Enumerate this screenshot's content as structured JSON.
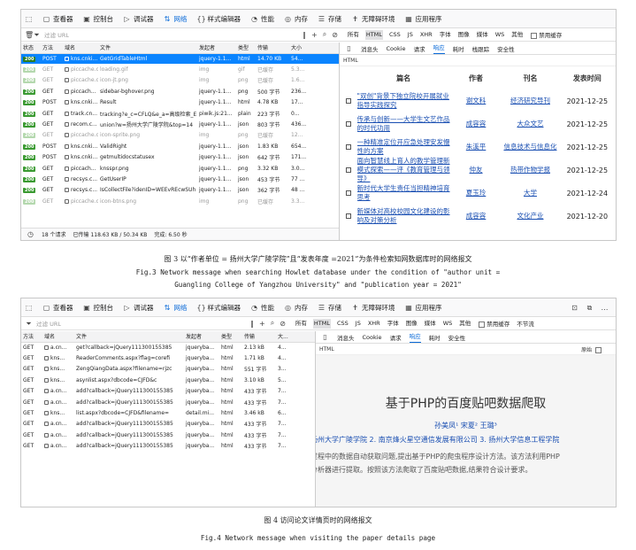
{
  "toolbar1": {
    "tabs": [
      {
        "icon": "▢",
        "label": "查看器"
      },
      {
        "icon": "▣",
        "label": "控制台"
      },
      {
        "icon": "▷",
        "label": "调试器"
      },
      {
        "icon": "⇅",
        "label": "网络",
        "selected": true
      },
      {
        "icon": "{}",
        "label": "样式编辑器"
      },
      {
        "icon": "◔",
        "label": "性能"
      },
      {
        "icon": "◎",
        "label": "内存"
      },
      {
        "icon": "☰",
        "label": "存储"
      },
      {
        "icon": "✝",
        "label": "无障碍环境"
      },
      {
        "icon": "▦",
        "label": "应用程序"
      }
    ]
  },
  "toolbar2": {
    "tabs": [
      {
        "icon": "▢",
        "label": "查看器"
      },
      {
        "icon": "▣",
        "label": "控制台"
      },
      {
        "icon": "▷",
        "label": "调试器"
      },
      {
        "icon": "⇅",
        "label": "网络",
        "selected": true
      },
      {
        "icon": "{}",
        "label": "样式编辑器"
      },
      {
        "icon": "◔",
        "label": "性能"
      },
      {
        "icon": "◎",
        "label": "内存"
      },
      {
        "icon": "☰",
        "label": "存储"
      },
      {
        "icon": "✝",
        "label": "无障碍环境"
      },
      {
        "icon": "▦",
        "label": "应用程序"
      }
    ]
  },
  "filter": {
    "placeholder": "过滤 URL",
    "types": [
      "所有",
      "HTML",
      "CSS",
      "JS",
      "XHR",
      "字体",
      "图像",
      "媒体",
      "WS",
      "其他"
    ],
    "active": "HTML",
    "persist": "禁用缓存",
    "throttle": "不节流"
  },
  "net1": {
    "headers": [
      "状态",
      "方法",
      "域名",
      "文件",
      "发起者",
      "类型",
      "传输",
      "大小"
    ],
    "rows": [
      {
        "status": "200",
        "method": "POST",
        "domain": "kns.cnki...",
        "file": "GetGridTableHtml",
        "initiator": "jquery-1.1...",
        "type": "html",
        "transfer": "14.70 KB",
        "size": "54...",
        "selected": true
      },
      {
        "status": "200",
        "method": "GET",
        "domain": "piccache.c...",
        "file": "loading.gif",
        "initiator": "img",
        "type": "gif",
        "transfer": "已缓存",
        "size": "5.3...",
        "dim": true
      },
      {
        "status": "200",
        "method": "GET",
        "domain": "piccache.c...",
        "file": "icon-jt.png",
        "initiator": "img",
        "type": "png",
        "transfer": "已缓存",
        "size": "1.6...",
        "dim": true
      },
      {
        "status": "200",
        "method": "GET",
        "domain": "piccach...",
        "file": "sidebar-bghover.png",
        "initiator": "jquery-1.1...",
        "type": "png",
        "transfer": "500 字节",
        "size": "236..."
      },
      {
        "status": "200",
        "method": "POST",
        "domain": "kns.cnki...",
        "file": "Result",
        "initiator": "jquery-1.1...",
        "type": "html",
        "transfer": "4.78 KB",
        "size": "17..."
      },
      {
        "status": "200",
        "method": "GET",
        "domain": "track.cn...",
        "file": "tracking?e_c=CFLQ&e_a=高级检索_E",
        "initiator": "piwik.js:21...",
        "type": "plain",
        "transfer": "223 字节",
        "size": "0..."
      },
      {
        "status": "200",
        "method": "GET",
        "domain": "recom.c...",
        "file": "union?w=扬州大学广陵学院&top=14",
        "initiator": "jquery-1.1...",
        "type": "json",
        "transfer": "803 字节",
        "size": "436..."
      },
      {
        "status": "200",
        "method": "GET",
        "domain": "piccache.c...",
        "file": "icon-sprite.png",
        "initiator": "img",
        "type": "png",
        "transfer": "已缓存",
        "size": "12...",
        "dim": true
      },
      {
        "status": "200",
        "method": "POST",
        "domain": "kns.cnki...",
        "file": "ValidRight",
        "initiator": "jquery-1.1...",
        "type": "json",
        "transfer": "1.83 KB",
        "size": "654..."
      },
      {
        "status": "200",
        "method": "POST",
        "domain": "kns.cnki...",
        "file": "getmultidocstatusex",
        "initiator": "jquery-1.1...",
        "type": "json",
        "transfer": "642 字节",
        "size": "171..."
      },
      {
        "status": "200",
        "method": "GET",
        "domain": "piccach...",
        "file": "knsspr.png",
        "initiator": "jquery-1.1...",
        "type": "png",
        "transfer": "3.32 KB",
        "size": "3.0..."
      },
      {
        "status": "200",
        "method": "GET",
        "domain": "recsys.c...",
        "file": "GetUserIP",
        "initiator": "jquery-1.1...",
        "type": "json",
        "transfer": "453 字节",
        "size": "77 ..."
      },
      {
        "status": "200",
        "method": "GET",
        "domain": "recsys.c...",
        "file": "IsCollectFile?idenID=WEEvREcwSUh",
        "initiator": "jquery-1.1...",
        "type": "json",
        "transfer": "362 字节",
        "size": "48 ..."
      },
      {
        "status": "200",
        "method": "GET",
        "domain": "piccache.c...",
        "file": "icon-btns.png",
        "initiator": "img",
        "type": "png",
        "transfer": "已缓存",
        "size": "3.3...",
        "dim": true
      }
    ],
    "status": {
      "requests": "18 个请求",
      "transferred": "已传输 118.63 KB / 50.34 KB",
      "finish": "完成: 6.50 秒"
    }
  },
  "detail1": {
    "tabs": [
      "消息头",
      "Cookie",
      "请求",
      "响应",
      "耗时",
      "栈跟踪",
      "安全性"
    ],
    "active": "响应",
    "label": "HTML",
    "columns": [
      "篇名",
      "作者",
      "刊名",
      "发表时间"
    ],
    "rows": [
      {
        "title": "\"双创\"背景下独立院校开展就业指导实践探究",
        "author": "谢文科",
        "journal": "经济研究导刊",
        "date": "2021-12-25"
      },
      {
        "title": "传承与创新——大学生文艺作品的时代功用",
        "author": "成容容",
        "journal": "大众文艺",
        "date": "2021-12-25"
      },
      {
        "title": "一种精准定位开应急处理安发慢性的方案",
        "author": "朱溪平",
        "journal": "信息技术与信息化",
        "date": "2021-12-25"
      },
      {
        "title": "面向智慧线上育人的教学管理新模式探索——评《教育管理与领导》",
        "author": "仲友",
        "journal": "热带作物学报",
        "date": "2021-12-25"
      },
      {
        "title": "新时代大学生责任当担精神培育思考",
        "author": "夏玉玲",
        "journal": "大学",
        "date": "2021-12-24"
      },
      {
        "title": "新媒体对高校校园文化建设的影响及对策分析",
        "author": "成容容",
        "journal": "文化产业",
        "date": "2021-12-20"
      }
    ]
  },
  "caption1": {
    "zh": "图 3 以“作者单位 = 扬州大学广陵学院”且“发表年度 =2021”为条件检索知网数据库时的网络报文",
    "en_line1": "Fig.3  Network message when searching Howlet database under the condition of \"author unit =",
    "en_line2": "Guangling College of Yangzhou University\" and \"publication year = 2021\""
  },
  "net2": {
    "headers": [
      "方法",
      "域名",
      "文件",
      "发起者",
      "类型",
      "传输",
      "大..."
    ],
    "rows": [
      {
        "method": "GET",
        "domain": "a.cn...",
        "file": "get?callback=jQuery111300155385",
        "initiator": "jqueryba...",
        "type": "html",
        "transfer": "2.13 kB",
        "size": "4..."
      },
      {
        "method": "GET",
        "domain": "kns...",
        "file": "ReaderComments.aspx?flag=corefi",
        "initiator": "jqueryba...",
        "type": "html",
        "transfer": "1.71 kB",
        "size": "4..."
      },
      {
        "method": "GET",
        "domain": "kns...",
        "file": "ZengQiangData.aspx?filename=rjzc",
        "initiator": "jqueryba...",
        "type": "html",
        "transfer": "551 字节",
        "size": "3..."
      },
      {
        "method": "GET",
        "domain": "kns...",
        "file": "asynlist.aspx?dbcode=CJFD&c",
        "initiator": "jqueryba...",
        "type": "html",
        "transfer": "3.10 kB",
        "size": "5..."
      },
      {
        "method": "GET",
        "domain": "a.cn...",
        "file": "add?callback=jQuery111300155385",
        "initiator": "jqueryba...",
        "type": "html",
        "transfer": "433 字节",
        "size": "7..."
      },
      {
        "method": "GET",
        "domain": "a.cn...",
        "file": "add?callback=jQuery111300155385",
        "initiator": "jqueryba...",
        "type": "html",
        "transfer": "433 字节",
        "size": "7..."
      },
      {
        "method": "GET",
        "domain": "kns...",
        "file": "list.aspx?dbcode=CJFD&filename=",
        "initiator": "detail.mi...",
        "type": "html",
        "transfer": "3.46 kB",
        "size": "6..."
      },
      {
        "method": "GET",
        "domain": "a.cn...",
        "file": "add?callback=jQuery111300155385",
        "initiator": "jqueryba...",
        "type": "html",
        "transfer": "433 字节",
        "size": "7..."
      },
      {
        "method": "GET",
        "domain": "a.cn...",
        "file": "add?callback=jQuery111300155385",
        "initiator": "jqueryba...",
        "type": "html",
        "transfer": "433 字节",
        "size": "7..."
      },
      {
        "method": "GET",
        "domain": "a.cn...",
        "file": "add?callback=jQuery111300155385",
        "initiator": "jqueryba...",
        "type": "html",
        "transfer": "433 字节",
        "size": "7..."
      }
    ]
  },
  "detail2": {
    "tabs": [
      "消息头",
      "Cookie",
      "请求",
      "响应",
      "耗时",
      "安全性"
    ],
    "active": "响应",
    "label": "HTML",
    "raw": "原始",
    "title": "基于PHP的百度贴吧数据爬取",
    "authors": "孙美凤¹    宋夏²    王璐³",
    "units": "扬州大学广陵学院   2. 南京烽火星空通信发展有限公司   3. 扬州大学信息工程学院",
    "abs1": "过程中的数据自动获取问题,提出基于PHP的爬虫程序设计方法。该方法利用PHP",
    "abs2": "分析器进行提取。按照该方法爬取了百度贴吧数据,结果符合设计要求。"
  },
  "caption2": {
    "zh": "图 4  访问论文详情页时的网络报文",
    "en": "Fig.4  Network message when visiting the paper details page"
  }
}
